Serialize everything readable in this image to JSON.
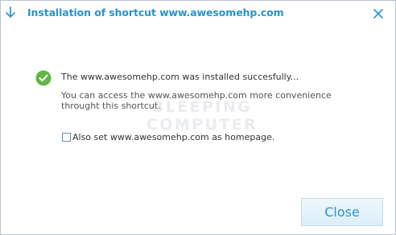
{
  "window": {
    "title": "Installation of shortcut www.awesomehp.com"
  },
  "message": {
    "main": "The www.awesomehp.com was installed succesfully...",
    "sub": "You can access the www.awesomehp.com more convenience throught this shortcut."
  },
  "options": {
    "homepage_label": "Also set www.awesomehp.com as homepage.",
    "homepage_checked": false
  },
  "buttons": {
    "close_label": "Close"
  },
  "watermark": {
    "text": "BLEEPING COMPUTER"
  },
  "icons": {
    "title": "download-arrow-icon",
    "close": "close-icon",
    "status": "success-check-icon"
  },
  "colors": {
    "accent": "#2a93c9",
    "success": "#5cb843",
    "border": "#b9c6d4",
    "button_bg": "#e3f1fa"
  }
}
